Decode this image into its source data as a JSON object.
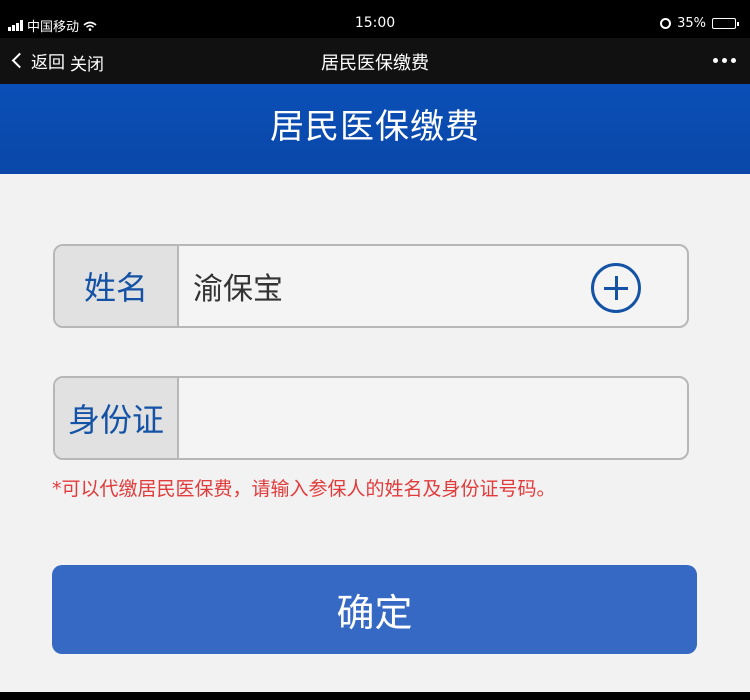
{
  "statusbar": {
    "carrier": "中国移动",
    "time": "15:00",
    "battery": "35%"
  },
  "navbar": {
    "back_label": "返回",
    "close_label": "关闭",
    "title": "居民医保缴费"
  },
  "header": {
    "title": "居民医保缴费"
  },
  "form": {
    "name_label": "姓名",
    "name_value": "渝保宝",
    "id_label": "身份证",
    "id_value": "",
    "hint": "*可以代缴居民医保费，请输入参保人的姓名及身份证号码。",
    "confirm_label": "确定"
  },
  "colors": {
    "header_blue": "#0a4fb7",
    "label_text": "#1452a6",
    "hint_red": "#e23b3b",
    "button_blue": "#3569c4"
  }
}
